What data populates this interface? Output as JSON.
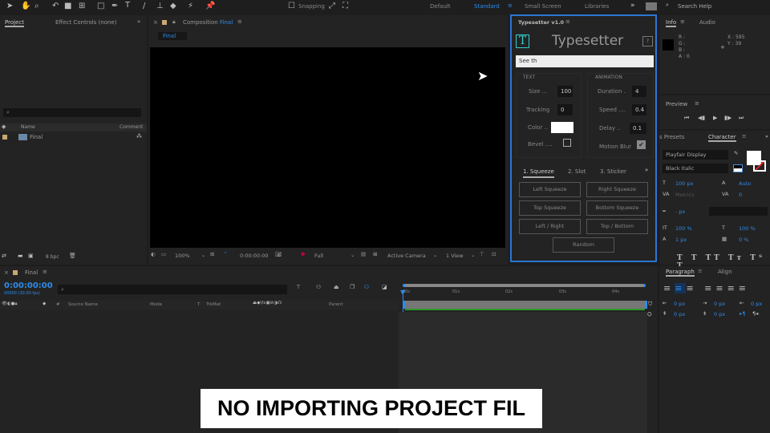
{
  "toolbar": {
    "snapping_label": "Snapping",
    "workspaces": [
      "Default",
      "Standard",
      "Small Screen",
      "Libraries"
    ],
    "active_workspace": "Standard",
    "search_placeholder": "Search Help",
    "more": "»"
  },
  "project": {
    "tab_project": "Project",
    "tab_effects": "Effect Controls (none)",
    "col_name": "Name",
    "col_comment": "Comment",
    "items": [
      {
        "name": "Final"
      }
    ],
    "bpc": "8 bpc"
  },
  "composition": {
    "tab_prefix": "Composition",
    "tab_name": "Final",
    "subtab": "Final",
    "zoom": "100%",
    "timecode": "0:00:00:00",
    "resolution": "Full",
    "camera": "Active Camera",
    "views": "1 View"
  },
  "typesetter": {
    "panel_title": "Typesetter v1.0",
    "logo_letter": "T",
    "title": "Typesetter",
    "help": "?",
    "text_input": "See th",
    "text_section": "TEXT",
    "animation_section": "ANIMATION",
    "size_label": "Size ...",
    "size": "100",
    "tracking_label": "Tracking",
    "tracking": "0",
    "color_label": "Color ..",
    "color": "#ffffff",
    "bevel_label": "Bevel ....",
    "bevel_checked": false,
    "duration_label": "Duration .",
    "duration": "4",
    "speed_label": "Speed ....",
    "speed": "0.4",
    "delay_label": "Delay ..",
    "delay": "0.1",
    "motion_blur_label": "Motion Blur",
    "motion_blur_checked": true,
    "tabs": [
      "1. Squeeze",
      "2. Slot",
      "3. Sticker"
    ],
    "active_tab": "1. Squeeze",
    "buttons": [
      "Left Squeeze",
      "Right Squeeze",
      "Top Squeeze",
      "Bottom Squeeze",
      "Left / Right",
      "Top / Bottom"
    ],
    "random_label": "Random"
  },
  "info": {
    "tab_info": "Info",
    "tab_audio": "Audio",
    "r": "R :",
    "g": "G :",
    "b": "B :",
    "a": "A : 0",
    "x": "X : 595",
    "y": "Y : 39"
  },
  "preview": {
    "title": "Preview"
  },
  "character": {
    "tab_presets": "s Presets",
    "tab_character": "Character",
    "font": "Playfair Display",
    "style": "Black Italic",
    "font_size": "100 px",
    "leading": "Auto",
    "kerning": "Metrics",
    "tracking": "0",
    "stroke": "- px",
    "vscale": "100 %",
    "hscale": "100 %",
    "baseline": "1 px",
    "tsume": "0 %"
  },
  "paragraph": {
    "tab_paragraph": "Paragraph",
    "tab_align": "Align",
    "indent1": "0 px",
    "indent2": "0 px",
    "indent3": "0 px",
    "space1": "0 px",
    "space2": "0 px"
  },
  "timeline": {
    "tab": "Final",
    "timecode": "0:00:00:00",
    "fps": "00000 (30.00 fps)",
    "cols": [
      "#",
      "Source Name",
      "Mode",
      "T",
      "TrkMat",
      "Parent"
    ],
    "ruler": [
      "00s",
      "01s",
      "02s",
      "03s",
      "04s"
    ]
  },
  "subtitle": "NO IMPORTING PROJECT FIL"
}
